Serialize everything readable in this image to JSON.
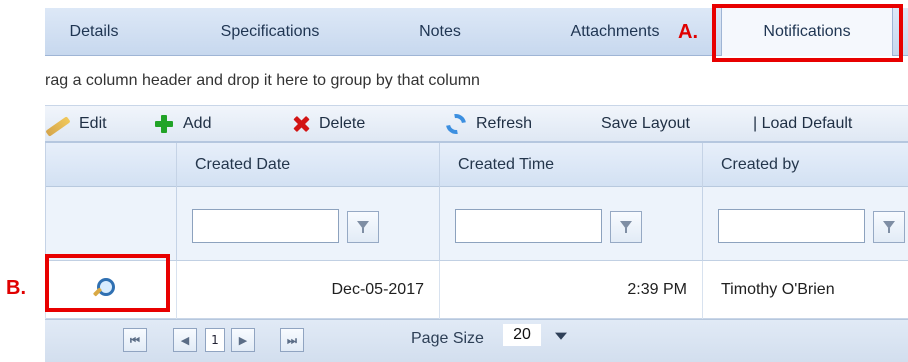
{
  "tabs": [
    {
      "label": "Details"
    },
    {
      "label": "Specifications"
    },
    {
      "label": "Notes"
    },
    {
      "label": "Attachments"
    },
    {
      "label": "Notifications"
    }
  ],
  "callouts": {
    "a": "A.",
    "b": "B."
  },
  "group_bar": {
    "text": "rag a column header and drop it here to group by that column"
  },
  "toolbar": {
    "edit": "Edit",
    "add": "Add",
    "delete": "Delete",
    "refresh": "Refresh",
    "save_layout": "Save Layout",
    "load_default": "| Load Default"
  },
  "grid": {
    "headers": [
      "Created Date",
      "Created Time",
      "Created by"
    ],
    "rows": [
      {
        "created_date": "Dec-05-2017",
        "created_time": "2:39 PM",
        "created_by": "Timothy O'Brien"
      }
    ]
  },
  "pager": {
    "current_page": "1",
    "page_size_label": "Page Size",
    "page_size_value": "20"
  },
  "colors": {
    "highlight": "#e80000",
    "tab_bg": "#c7d8ee",
    "header_bg": "#d3e1f3"
  },
  "icons": {
    "edit": "pencil-icon",
    "add": "plus-icon",
    "delete": "delete-x-icon",
    "refresh": "refresh-icon",
    "filter": "filter-icon",
    "view": "magnifier-icon",
    "first": "first-page-icon",
    "prev": "previous-page-icon",
    "next": "next-page-icon",
    "last": "last-page-icon"
  }
}
